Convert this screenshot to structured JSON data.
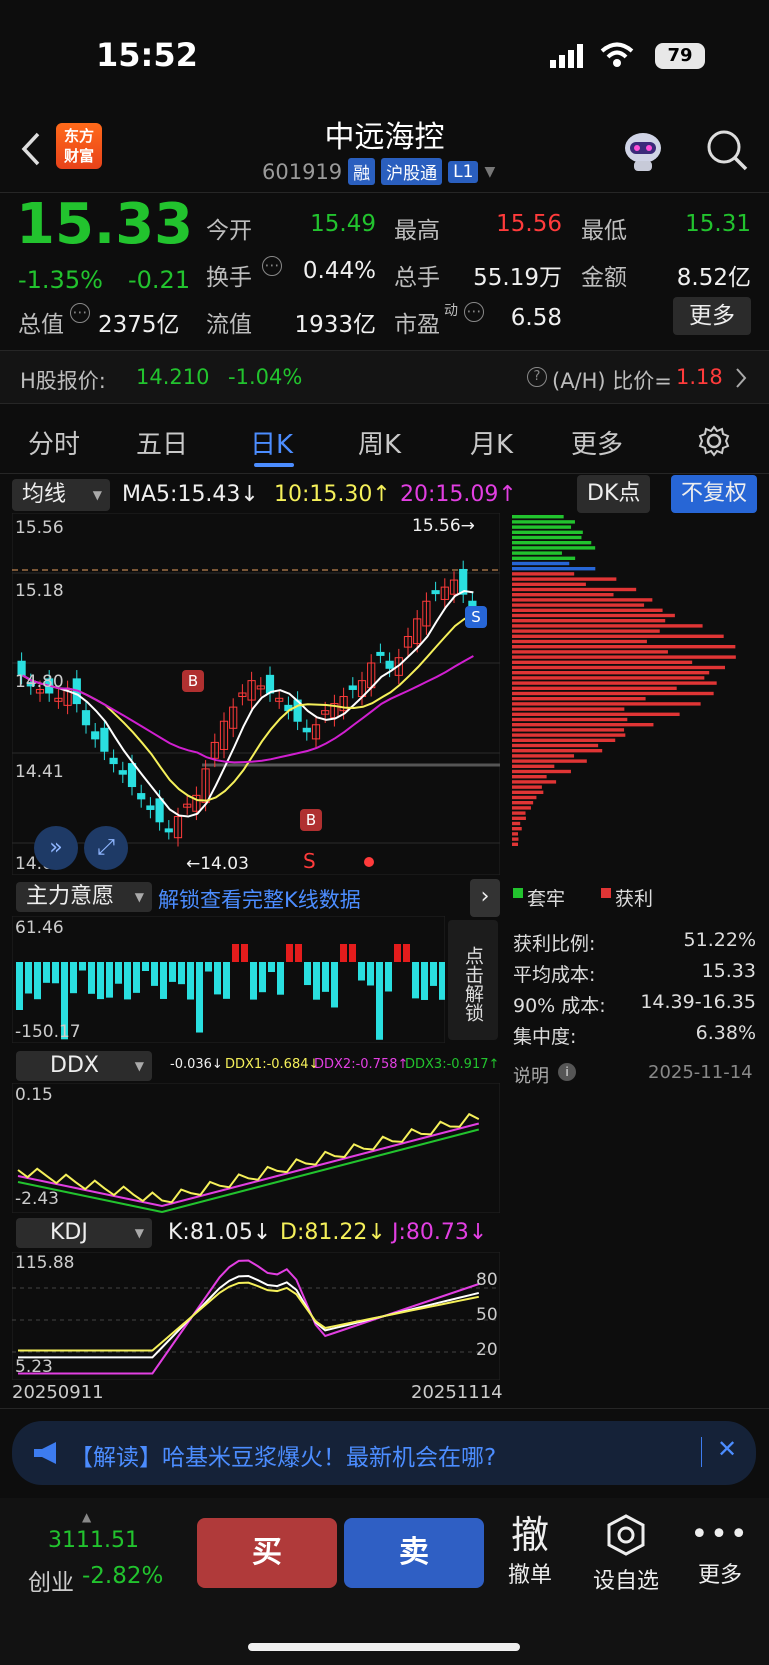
{
  "status": {
    "time": "15:52",
    "battery": "79"
  },
  "header": {
    "title": "中远海控",
    "code": "601919",
    "tags": [
      "融",
      "沪股通",
      "L1"
    ],
    "logo_text_1": "东方",
    "logo_text_2": "财富"
  },
  "quote": {
    "price": "15.33",
    "change_pct": "-1.35%",
    "change": "-0.21",
    "open_label": "今开",
    "open": "15.49",
    "high_label": "最高",
    "high": "15.56",
    "low_label": "最低",
    "low": "15.31",
    "turnover_label": "换手",
    "turnover": "0.44%",
    "volume_label": "总手",
    "volume": "55.19万",
    "amount_label": "金额",
    "amount": "8.52亿",
    "mktcap_label": "总值",
    "mktcap": "2375亿",
    "float_label": "流值",
    "float": "1933亿",
    "pe_label": "市盈",
    "pe_sup": "动",
    "pe": "6.58",
    "more": "更多"
  },
  "hshare": {
    "label": "H股报价:",
    "price": "14.210",
    "change": "-1.04%",
    "ratio_label": "(A/H) 比价=",
    "ratio": "1.18"
  },
  "tabs": [
    "分时",
    "五日",
    "日K",
    "周K",
    "月K",
    "更多",
    "gear-icon"
  ],
  "active_tab": "日K",
  "kline": {
    "ma_selector": "均线",
    "ma5": "MA5:15.43↓",
    "ma10": "10:15.30↑",
    "ma20": "20:15.09↑",
    "dk": "DK点",
    "fq": "不复权",
    "y_labels": [
      "15.56",
      "15.18",
      "14.80",
      "14.41",
      "14.03"
    ],
    "high_mark": "15.56→",
    "low_mark": "←14.03",
    "signal_b": "B",
    "signal_s": "S",
    "sig_s_text": "S",
    "colors": {
      "up": "#ff3b3b",
      "down": "#2adfe0",
      "ma5": "#ffffff",
      "ma10": "#f5f05a",
      "ma20": "#d01fd0"
    }
  },
  "indicator1": {
    "selector": "主力意愿",
    "unlock": "解锁查看完整K线数据",
    "top": "61.46",
    "bottom": "-150.17",
    "side_unlock": "点击解锁"
  },
  "chips": {
    "legend_trapped": "套牢",
    "legend_profit": "获利",
    "rows": [
      {
        "label": "获利比例:",
        "value": "51.22%"
      },
      {
        "label": "平均成本:",
        "value": "15.33"
      },
      {
        "label": "90% 成本:",
        "value": "14.39-16.35"
      },
      {
        "label": "集中度:",
        "value": "6.38%"
      }
    ],
    "note": "说明",
    "date": "2025-11-14"
  },
  "ddx": {
    "selector": "DDX",
    "v": "-0.036↓",
    "ddx1": "DDX1:-0.684↓",
    "ddx2": "DDX2:-0.758↑",
    "ddx3": "DDX3:-0.917↑",
    "top": "0.15",
    "bottom": "-2.43"
  },
  "kdj": {
    "selector": "KDJ",
    "k": "K:81.05↓",
    "d": "D:81.22↓",
    "j": "J:80.73↓",
    "top": "115.88",
    "bottom": "5.23",
    "levels": [
      "80",
      "50",
      "20"
    ],
    "date_start": "20250911",
    "date_end": "20251114"
  },
  "banner": {
    "text": "【解读】哈基米豆浆爆火！最新机会在哪?"
  },
  "bottom": {
    "index_value": "3111.51",
    "index_name": "创业",
    "index_change": "-2.82%",
    "buy": "买",
    "sell": "卖",
    "cancel_icon": "撤",
    "cancel": "撤单",
    "watch": "设自选",
    "more": "更多"
  }
}
